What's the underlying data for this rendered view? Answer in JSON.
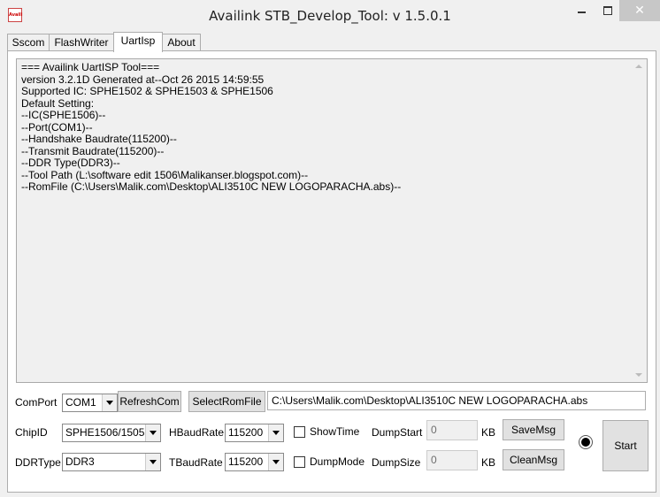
{
  "window": {
    "title": "Availink STB_Develop_Tool: v 1.5.0.1",
    "icon_text": "Availi"
  },
  "tabs": [
    "Sscom",
    "FlashWriter",
    "UartIsp",
    "About"
  ],
  "log_text": "=== Availink UartISP Tool===\nversion 3.2.1D Generated at--Oct 26 2015 14:59:55\nSupported IC: SPHE1502 & SPHE1503 & SPHE1506\nDefault Setting:\n--IC(SPHE1506)--\n--Port(COM1)--\n--Handshake Baudrate(115200)--\n--Transmit Baudrate(115200)--\n--DDR Type(DDR3)--\n--Tool Path (L:\\software edit 1506\\Malikanser.blogspot.com)--\n--RomFile (C:\\Users\\Malik.com\\Desktop\\ALI3510C NEW LOGOPARACHA.abs)--",
  "controls": {
    "comport_label": "ComPort",
    "comport_value": "COM1",
    "refresh_btn": "RefreshCom",
    "select_rom_btn": "SelectRomFile",
    "rom_path": "C:\\Users\\Malik.com\\Desktop\\ALI3510C NEW LOGOPARACHA.abs",
    "chipid_label": "ChipID",
    "chipid_value": "SPHE1506/1505",
    "hbaud_label": "HBaudRate",
    "hbaud_value": "115200",
    "showtime_label": "ShowTime",
    "dumpstart_label": "DumpStart",
    "dumpstart_value": "0",
    "kb1": "KB",
    "savemsg_btn": "SaveMsg",
    "ddrtype_label": "DDRType",
    "ddrtype_value": "DDR3",
    "tbaud_label": "TBaudRate",
    "tbaud_value": "115200",
    "dumpmode_label": "DumpMode",
    "dumpsize_label": "DumpSize",
    "dumpsize_value": "0",
    "kb2": "KB",
    "cleanmsg_btn": "CleanMsg",
    "start_btn": "Start"
  }
}
